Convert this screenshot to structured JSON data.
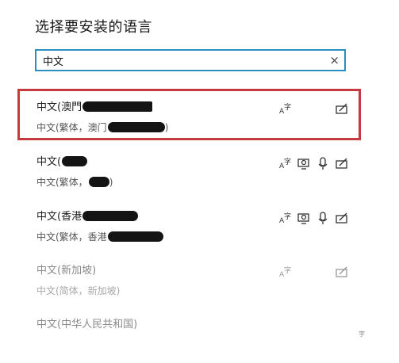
{
  "title": "选择要安装的语言",
  "search": {
    "value": "中文",
    "clear_glyph": "×"
  },
  "languages": [
    {
      "name": "中文(澳門",
      "region": "中文(繁体，澳门",
      "region_suffix": ")",
      "icons": [
        "text-icon",
        "handwriting-icon"
      ],
      "disabled": false
    },
    {
      "name": "中文(",
      "region": "中文(繁体，",
      "region_suffix": ")",
      "icons": [
        "text-icon",
        "speech-icon",
        "mic-icon",
        "handwriting-icon"
      ],
      "disabled": false
    },
    {
      "name": "中文(香港",
      "region": "中文(繁体，香港",
      "region_suffix": "",
      "icons": [
        "text-icon",
        "speech-icon",
        "mic-icon",
        "handwriting-icon"
      ],
      "disabled": false
    },
    {
      "name": "中文(新加坡)",
      "region": "中文(简体，新加坡)",
      "region_suffix": "",
      "icons": [
        "text-icon",
        "handwriting-icon"
      ],
      "disabled": true
    },
    {
      "name": "中文(中华人民共和国)",
      "region": "",
      "region_suffix": "",
      "icons": [],
      "disabled": true
    }
  ],
  "colors": {
    "accent": "#2b8fbd",
    "highlight": "#c5393f",
    "redaction": "#141414"
  }
}
